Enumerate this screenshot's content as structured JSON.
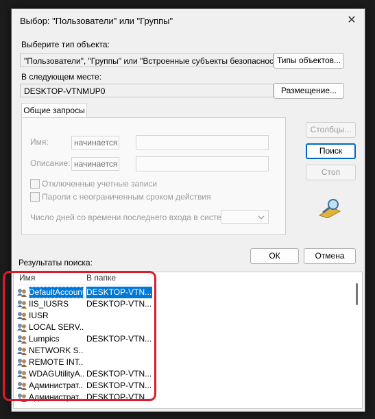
{
  "window": {
    "title": "Выбор: \"Пользователи\" или \"Группы\"",
    "close_glyph": "✕"
  },
  "object_type": {
    "label": "Выберите тип объекта:",
    "value": "\"Пользователи\", \"Группы\" или \"Встроенные субъекты безопасности\"",
    "button": "Типы объектов..."
  },
  "location": {
    "label": "В следующем месте:",
    "value": "DESKTOP-VTNMUP0",
    "button": "Размещение..."
  },
  "queries": {
    "tab": "Общие запросы",
    "name_label": "Имя:",
    "name_mode": "начинается с",
    "desc_label": "Описание:",
    "desc_mode": "начинается с",
    "disabled_accounts": "Отключенные учетные записи",
    "no_expire_pwd": "Пароли с неограниченным сроком действия",
    "days_label": "Число дней со времени последнего входа в систему:"
  },
  "side_buttons": {
    "columns": "Столбцы...",
    "search": "Поиск",
    "stop": "Стоп"
  },
  "footer": {
    "results_label": "Результаты поиска:",
    "ok": "ОК",
    "cancel": "Отмена"
  },
  "results": {
    "columns": [
      "Имя",
      "В папке"
    ],
    "rows": [
      {
        "name": "DefaultAccount",
        "place": "DESKTOP-VTN..."
      },
      {
        "name": "IIS_IUSRS",
        "place": "DESKTOP-VTN..."
      },
      {
        "name": "IUSR",
        "place": ""
      },
      {
        "name": "LOCAL SERV...",
        "place": ""
      },
      {
        "name": "Lumpics",
        "place": "DESKTOP-VTN..."
      },
      {
        "name": "NETWORK S...",
        "place": ""
      },
      {
        "name": "REMOTE INT...",
        "place": ""
      },
      {
        "name": "WDAGUtilityA...",
        "place": "DESKTOP-VTN..."
      },
      {
        "name": "Администрат...",
        "place": "DESKTOP-VTN..."
      },
      {
        "name": "Администрат...",
        "place": "DESKTOP-VTN..."
      }
    ]
  },
  "colors": {
    "highlight": "#e0192b",
    "selection": "#0078d7",
    "primary_border": "#0067c0"
  }
}
